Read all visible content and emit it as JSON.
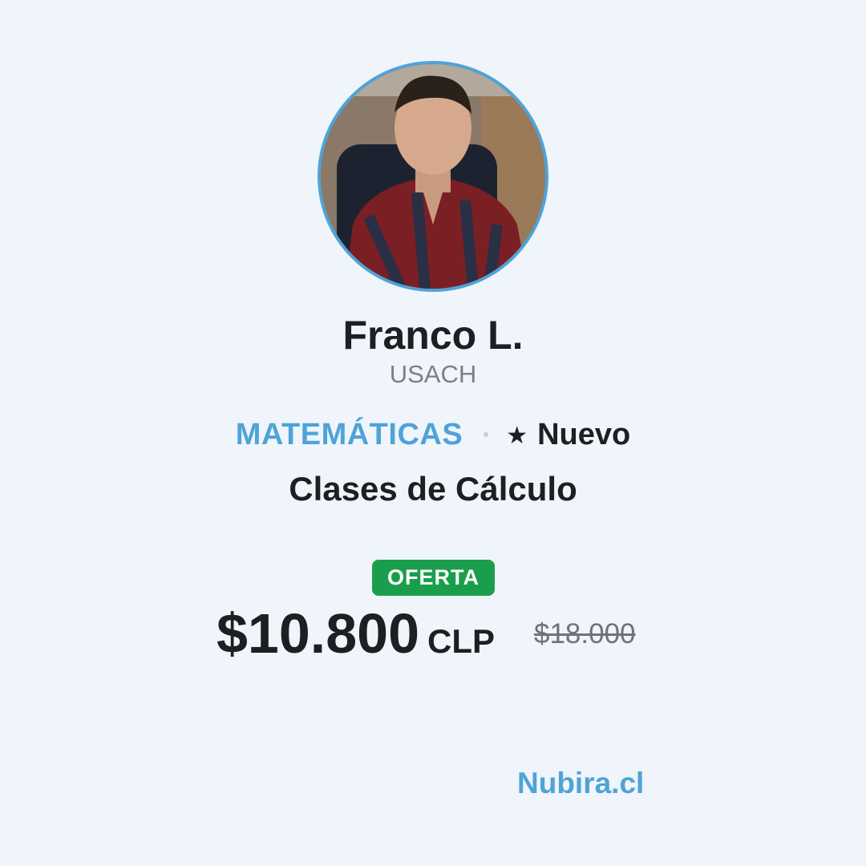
{
  "tutor": {
    "name": "Franco L.",
    "university": "USACH"
  },
  "course": {
    "subject": "MATEMÁTICAS",
    "status_icon": "star-icon",
    "status": "Nuevo",
    "title": "Clases de Cálculo"
  },
  "pricing": {
    "badge": "OFERTA",
    "amount": "$10.800",
    "currency": "CLP",
    "original": "$18.000"
  },
  "brand": "Nubira.cl",
  "colors": {
    "accent": "#4fa3d8",
    "offer_badge": "#1a9e4b",
    "background": "#eff5fa",
    "text": "#1d1f22",
    "muted": "#7b8088"
  }
}
